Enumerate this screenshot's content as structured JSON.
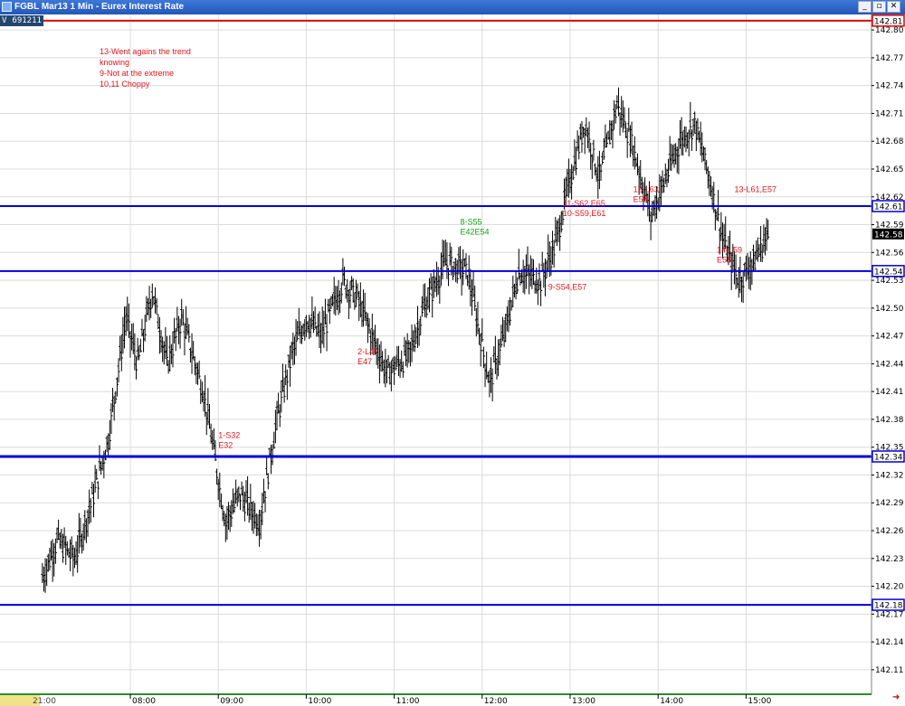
{
  "window": {
    "title": "FGBL Mar13 1 Min - Eurex Interest Rate",
    "buttons": {
      "minimize": "_",
      "restore": "▫",
      "close": "✕"
    }
  },
  "instrument": {
    "prefix": "V",
    "code": "691211"
  },
  "notes": [
    "13-Went agains the trend",
    "knowing",
    "9-Not at the extreme",
    "10,11 Choppy"
  ],
  "colors": {
    "level_line": "#0000dd",
    "top_line": "#e00000",
    "annotation_red": "#e0161e",
    "annotation_green": "#12a012",
    "bars": "#000000",
    "grid": "#dcdcdc"
  },
  "chart_data": {
    "type": "bar",
    "title": "FGBL Mar13 1 Min - Eurex Interest Rate",
    "x_ticks": [
      "08:00",
      "09:00",
      "10:00",
      "11:00",
      "12:00",
      "13:00",
      "14:00",
      "15:00"
    ],
    "x_start_label": "21:00",
    "ylim": [
      142.1,
      142.82
    ],
    "y_ticks": [
      142.8,
      142.77,
      142.74,
      142.71,
      142.68,
      142.65,
      142.62,
      142.59,
      142.56,
      142.53,
      142.5,
      142.47,
      142.44,
      142.41,
      142.38,
      142.35,
      142.32,
      142.29,
      142.26,
      142.23,
      142.2,
      142.17,
      142.14,
      142.11
    ],
    "price_lines": [
      {
        "value": 142.81,
        "label": "142.81",
        "color": "#e00000"
      },
      {
        "value": 142.61,
        "label": "142.61",
        "color": "#0000dd"
      },
      {
        "value": 142.54,
        "label": "142.54",
        "color": "#0000dd"
      },
      {
        "value": 142.34,
        "label": "142.34",
        "color": "#0000dd"
      },
      {
        "value": 142.18,
        "label": "142.18",
        "color": "#0000dd"
      }
    ],
    "last_price": {
      "value": 142.58,
      "label": "142.58"
    },
    "annotations": [
      {
        "lines": [
          "1-S32",
          "E32"
        ],
        "time": "09:00",
        "price": 142.36,
        "color": "#e0161e"
      },
      {
        "lines": [
          "2-L47",
          "E47"
        ],
        "time": "10:35",
        "price": 142.45,
        "color": "#e0161e"
      },
      {
        "lines": [
          "8-S55",
          "E42E54"
        ],
        "time": "11:45",
        "price": 142.59,
        "color": "#12a012"
      },
      {
        "lines": [
          "9-S54,E57"
        ],
        "time": "12:45",
        "price": 142.52,
        "color": "#e0161e"
      },
      {
        "lines": [
          "11-S62,E65",
          "10-S59,E61"
        ],
        "time": "12:55",
        "price": 142.61,
        "color": "#e0161e"
      },
      {
        "lines": [
          "12-L63",
          "E58"
        ],
        "time": "13:43",
        "price": 142.625,
        "color": "#e0161e"
      },
      {
        "lines": [
          "13-L61,E57"
        ],
        "time": "14:52",
        "price": 142.625,
        "color": "#e0161e"
      },
      {
        "lines": [
          "14-L59",
          "E55"
        ],
        "time": "14:40",
        "price": 142.56,
        "color": "#e0161e"
      }
    ],
    "price_path": [
      [
        "07:00",
        142.21
      ],
      [
        "07:10",
        142.25
      ],
      [
        "07:22",
        142.23
      ],
      [
        "07:35",
        142.3
      ],
      [
        "07:45",
        142.36
      ],
      [
        "07:57",
        142.49
      ],
      [
        "08:05",
        142.44
      ],
      [
        "08:15",
        142.52
      ],
      [
        "08:25",
        142.44
      ],
      [
        "08:35",
        142.49
      ],
      [
        "08:50",
        142.41
      ],
      [
        "09:05",
        142.27
      ],
      [
        "09:15",
        142.3
      ],
      [
        "09:28",
        142.27
      ],
      [
        "09:40",
        142.38
      ],
      [
        "09:50",
        142.45
      ],
      [
        "10:00",
        142.49
      ],
      [
        "10:10",
        142.47
      ],
      [
        "10:25",
        142.53
      ],
      [
        "10:35",
        142.51
      ],
      [
        "10:45",
        142.47
      ],
      [
        "10:55",
        142.43
      ],
      [
        "11:10",
        142.45
      ],
      [
        "11:20",
        142.5
      ],
      [
        "11:35",
        142.55
      ],
      [
        "11:50",
        142.54
      ],
      [
        "12:05",
        142.42
      ],
      [
        "12:15",
        142.47
      ],
      [
        "12:25",
        142.54
      ],
      [
        "12:40",
        142.53
      ],
      [
        "12:50",
        142.57
      ],
      [
        "13:00",
        142.64
      ],
      [
        "13:10",
        142.7
      ],
      [
        "13:20",
        142.64
      ],
      [
        "13:32",
        142.72
      ],
      [
        "13:42",
        142.68
      ],
      [
        "13:55",
        142.6
      ],
      [
        "14:05",
        142.64
      ],
      [
        "14:15",
        142.68
      ],
      [
        "14:25",
        142.7
      ],
      [
        "14:35",
        142.64
      ],
      [
        "14:45",
        142.57
      ],
      [
        "14:55",
        142.53
      ],
      [
        "15:05",
        142.55
      ],
      [
        "15:15",
        142.58
      ]
    ]
  }
}
